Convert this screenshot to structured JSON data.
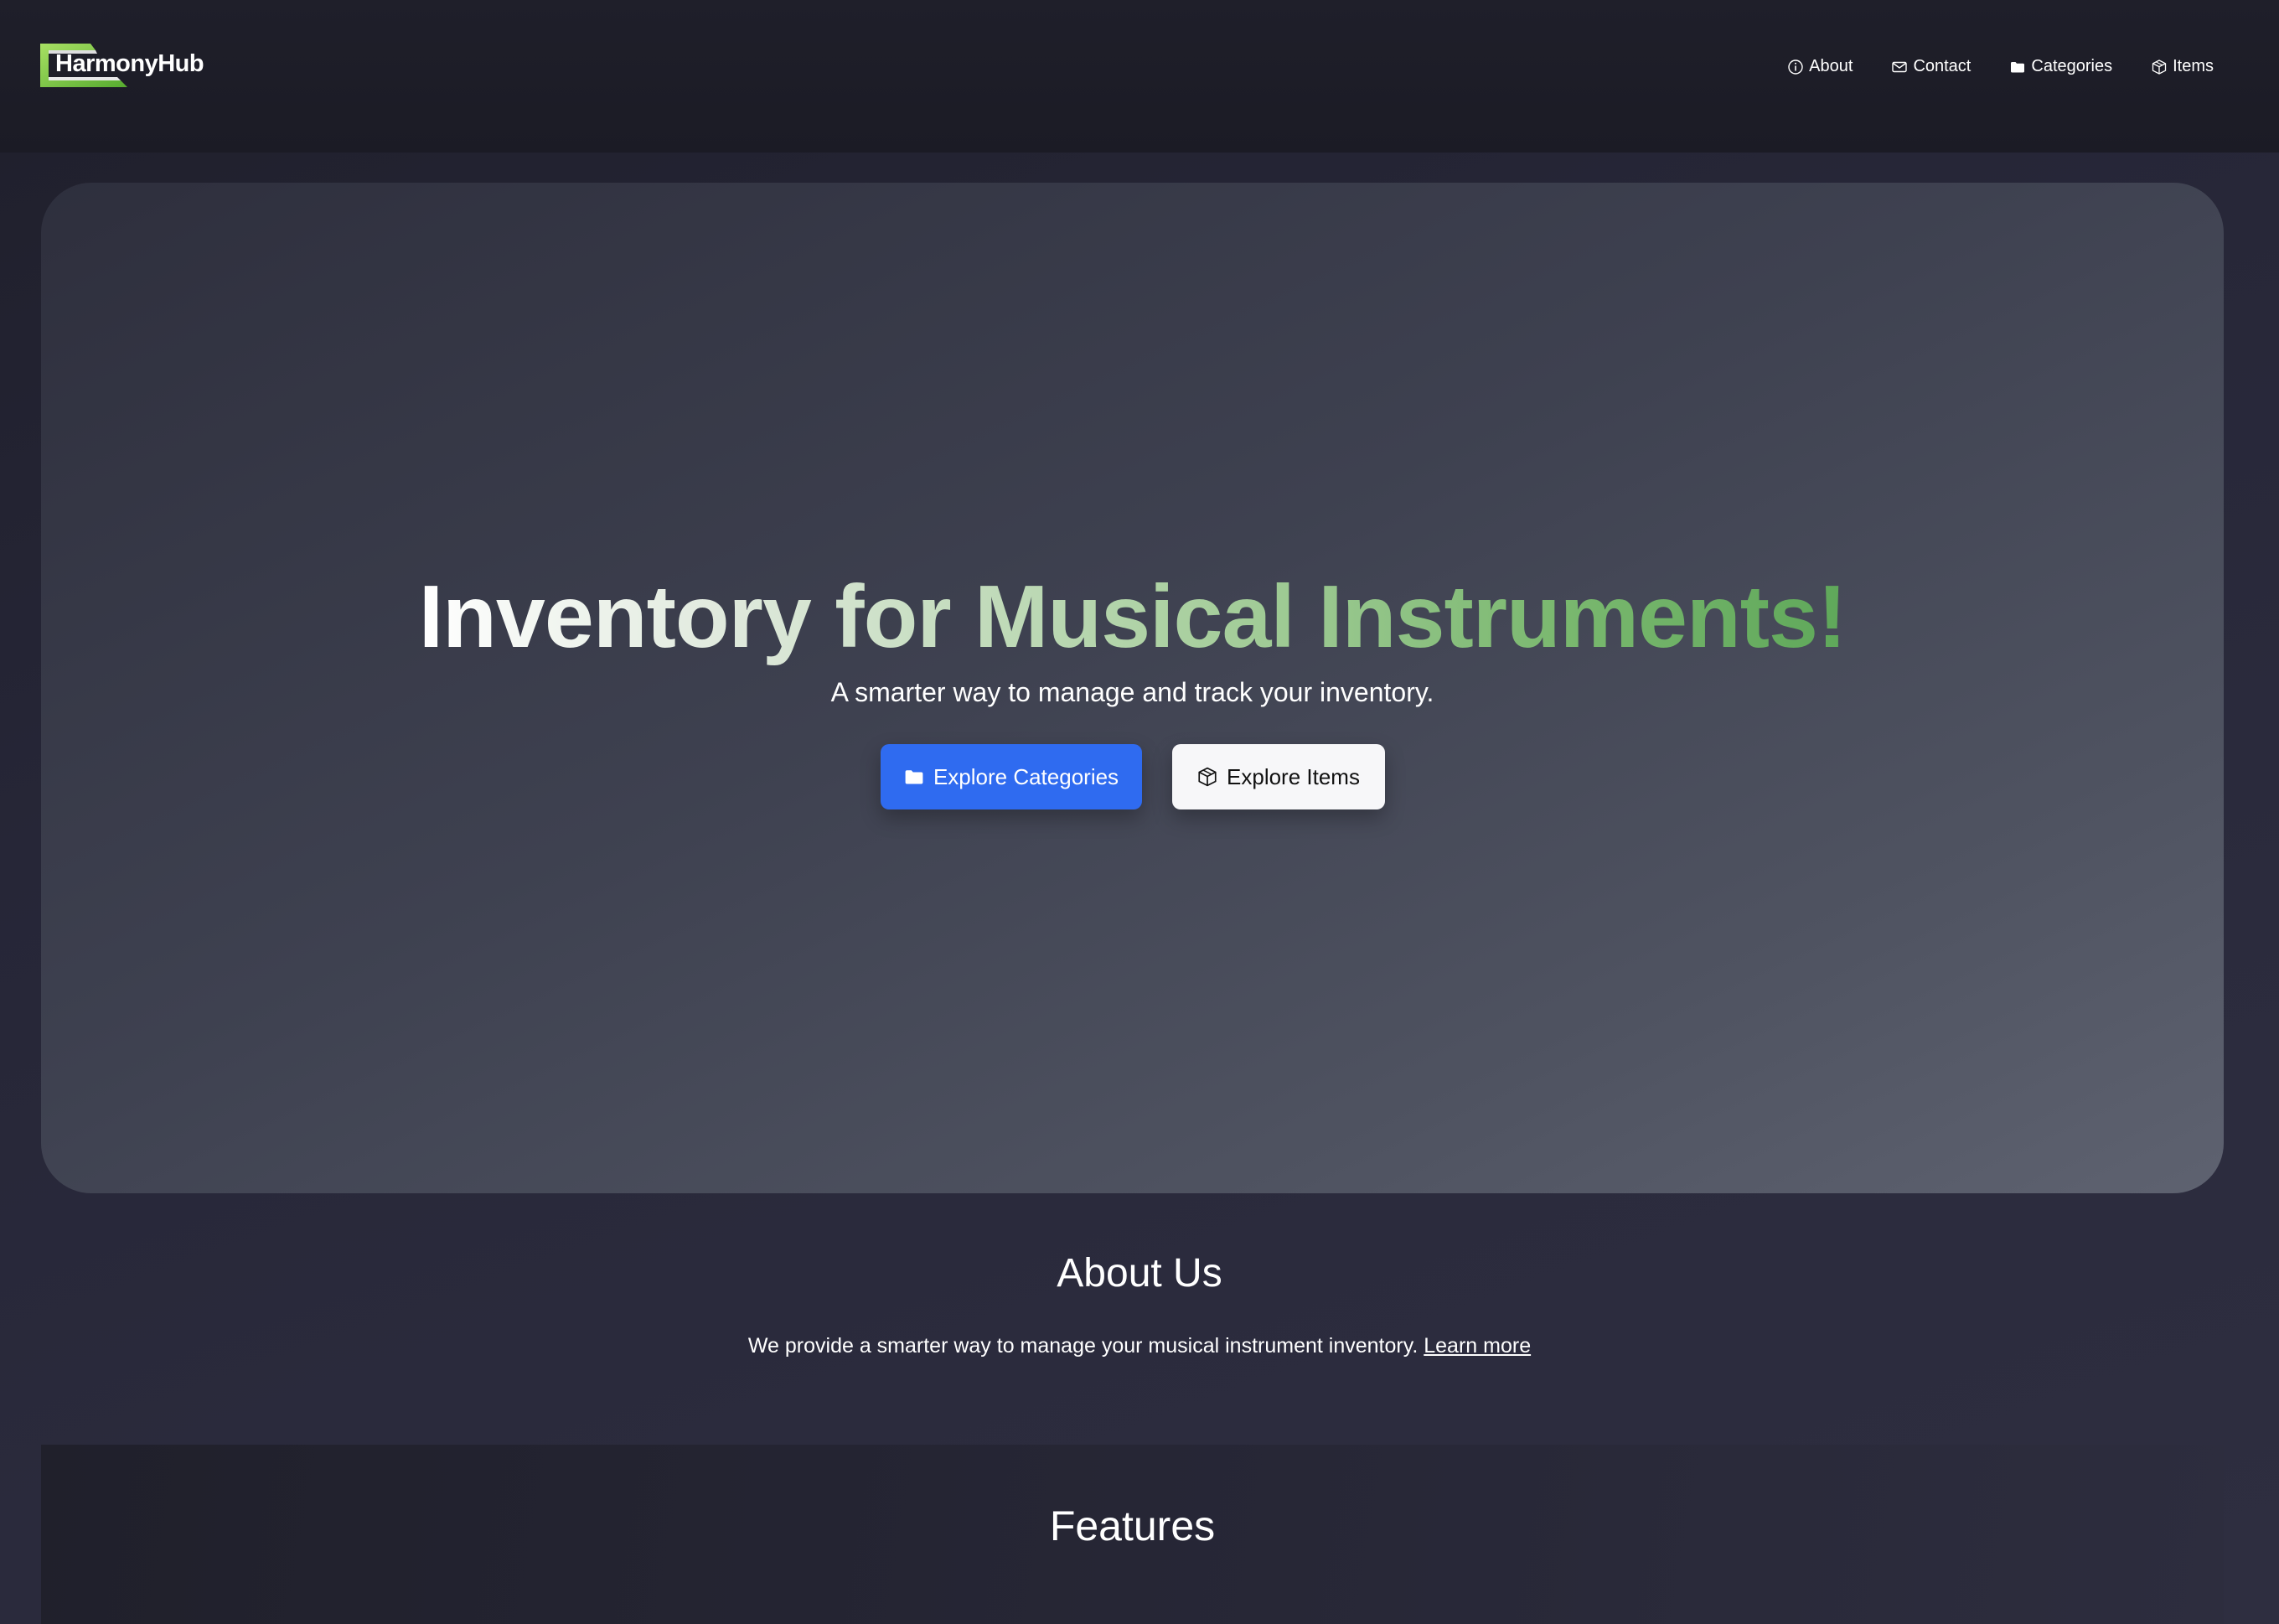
{
  "brand": {
    "name": "HarmonyHub",
    "logo_colors": [
      "#a8e063",
      "#56ab2f"
    ]
  },
  "nav": {
    "items": [
      {
        "label": "About",
        "icon": "info-circle-icon"
      },
      {
        "label": "Contact",
        "icon": "envelope-icon"
      },
      {
        "label": "Categories",
        "icon": "folder-icon"
      },
      {
        "label": "Items",
        "icon": "box-icon"
      }
    ]
  },
  "hero": {
    "title": "Inventory for Musical Instruments!",
    "subtitle": "A smarter way to manage and track your inventory.",
    "primary_button": {
      "label": "Explore Categories",
      "icon": "folder-icon",
      "color": "#2f6bf0"
    },
    "secondary_button": {
      "label": "Explore Items",
      "icon": "box-icon",
      "color": "#f7f7f9"
    }
  },
  "about": {
    "title": "About Us",
    "text": "We provide a smarter way to manage your musical instrument inventory.",
    "link_label": "Learn more"
  },
  "features": {
    "title": "Features"
  }
}
